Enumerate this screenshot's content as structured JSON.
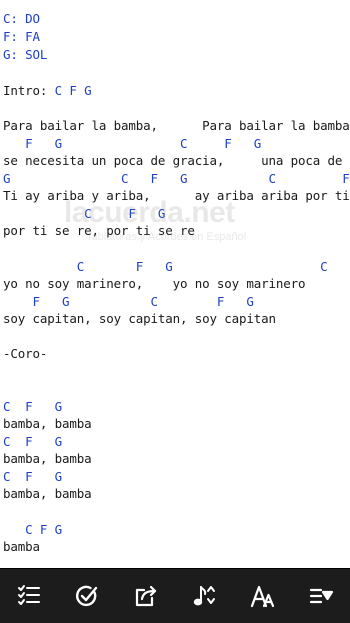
{
  "song": {
    "key_mappings": [
      "C: DO",
      "F: FA",
      "G: SOL"
    ],
    "intro_label": "Intro:",
    "intro_chords": "C F G",
    "verse_1": {
      "lyric_1": "Para bailar la bamba,      Para bailar la bamba",
      "chords_2": "   F   G                C     F   G",
      "lyric_2": "se necesita un poca de gracia,     una poca de",
      "chords_3": "G               C   F   G           C         F",
      "lyric_3": "Ti ay ariba y ariba,      ay ariba ariba por ti",
      "chords_4": "           C     F   G",
      "lyric_4": "por ti se re, por ti se re"
    },
    "verse_2": {
      "chords_1": "          C       F   G                    C",
      "lyric_1": "yo no soy marinero,    yo no soy marinero",
      "chords_2": "    F   G           C        F   G",
      "lyric_2": "soy capitan, soy capitan, soy capitan"
    },
    "coro_label": "-Coro-",
    "coro": [
      {
        "chords": "C  F   G",
        "lyric": "bamba, bamba"
      },
      {
        "chords": "C  F   G",
        "lyric": "bamba, bamba"
      },
      {
        "chords": "C  F   G",
        "lyric": "bamba, bamba"
      },
      {
        "chords": "   C F G",
        "lyric": "bamba"
      }
    ]
  },
  "watermark": {
    "name": "lacuerda.net",
    "tagline": "Tablaturas y Acordes en Español"
  },
  "toolbar": {
    "items": [
      {
        "name": "song-list",
        "icon": "checklist-icon"
      },
      {
        "name": "mark-done",
        "icon": "check-circle-icon"
      },
      {
        "name": "share",
        "icon": "share-icon"
      },
      {
        "name": "transpose",
        "icon": "music-note-transpose-icon"
      },
      {
        "name": "font-size",
        "icon": "font-size-icon"
      },
      {
        "name": "autoscroll",
        "icon": "list-down-icon"
      }
    ],
    "icon_color": "#ffffff",
    "background": "#1c1c1c"
  },
  "colors": {
    "chord": "#1f3fc8",
    "lyric": "#1a1a1a"
  }
}
